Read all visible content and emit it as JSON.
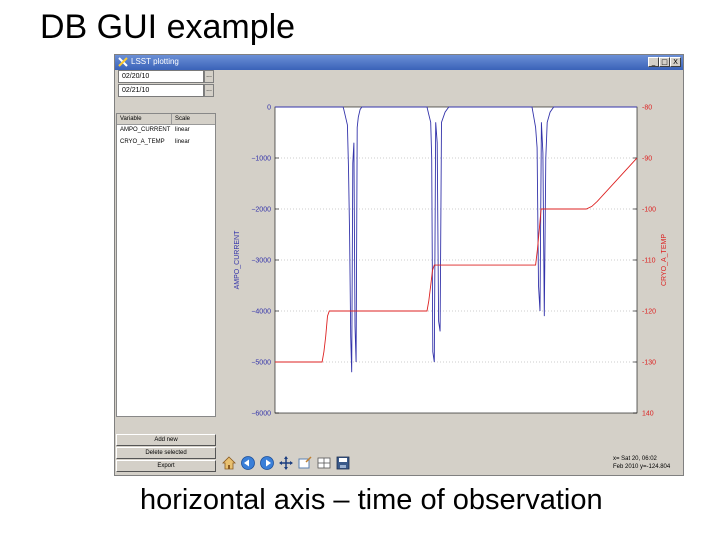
{
  "slide": {
    "title": "DB GUI example",
    "caption": "horizontal axis – time of observation"
  },
  "window": {
    "title": "LSST plotting",
    "controls": {
      "minimize": "_",
      "maximize": "□",
      "close": "X"
    }
  },
  "left_panel": {
    "start_date": "02/20/10",
    "end_date": "02/21/10",
    "picker_label": "...",
    "columns": [
      "Variable",
      "Scale"
    ],
    "rows": [
      {
        "variable": "AMPO_CURRENT",
        "scale": "linear"
      },
      {
        "variable": "CRYO_A_TEMP",
        "scale": "linear"
      }
    ],
    "buttons": {
      "add": "Add new",
      "delete": "Delete selected",
      "export": "Export"
    }
  },
  "toolbar": {
    "icons": [
      "home-icon",
      "back-icon",
      "forward-icon",
      "pan-icon",
      "zoom-icon",
      "subplots-icon",
      "save-icon"
    ],
    "coord_line1": "x= Sat 20, 06:02",
    "coord_line2": "Feb 2010 y=-124.804"
  },
  "colors": {
    "left_series": "#3333aa",
    "right_series": "#dd2222"
  },
  "chart_data": {
    "type": "line",
    "xlabel": "",
    "grid": true,
    "left_axis": {
      "label": "AMPO_CURRENT",
      "ylim": [
        -6000,
        0
      ],
      "ticks": [
        "0",
        "−1000",
        "−2000",
        "−3000",
        "−4000",
        "−5000",
        "−6000"
      ]
    },
    "right_axis": {
      "label": "CRYO_A_TEMP",
      "ylim": [
        -140,
        -80
      ],
      "ticks": [
        "-80",
        "-90",
        "-100",
        "-110",
        "-120",
        "-130",
        "140"
      ]
    },
    "series": [
      {
        "name": "AMPO_CURRENT",
        "axis": "left",
        "x": [
          0,
          0.188,
          0.19,
          0.195,
          0.2,
          0.203,
          0.206,
          0.209,
          0.212,
          0.215,
          0.218,
          0.221,
          0.224,
          0.227,
          0.23,
          0.235,
          0.24,
          0.42,
          0.425,
          0.43,
          0.433,
          0.436,
          0.44,
          0.444,
          0.448,
          0.452,
          0.456,
          0.46,
          0.47,
          0.48,
          0.71,
          0.715,
          0.72,
          0.724,
          0.728,
          0.732,
          0.736,
          0.74,
          0.744,
          0.748,
          0.752,
          0.76,
          0.77,
          1
        ],
        "y": [
          0,
          0,
          -50,
          -200,
          -350,
          -1200,
          -2500,
          -4500,
          -5200,
          -1100,
          -700,
          -4300,
          -5000,
          -400,
          -200,
          -50,
          0,
          0,
          -150,
          -300,
          -1000,
          -4800,
          -5000,
          -300,
          -700,
          -4200,
          -4400,
          -300,
          -100,
          0,
          0,
          -200,
          -400,
          -800,
          -3500,
          -4000,
          -300,
          -900,
          -4100,
          -1000,
          -300,
          -100,
          0,
          0
        ]
      },
      {
        "name": "CRYO_A_TEMP",
        "axis": "right",
        "x": [
          0,
          0.13,
          0.135,
          0.14,
          0.145,
          0.15,
          0.42,
          0.425,
          0.43,
          0.435,
          0.44,
          0.72,
          0.725,
          0.73,
          0.735,
          0.86,
          0.875,
          0.89,
          1
        ],
        "y": [
          -130,
          -130,
          -128,
          -125,
          -121,
          -120,
          -120,
          -118,
          -115,
          -112,
          -111,
          -111,
          -108,
          -104,
          -100,
          -100,
          -99.5,
          -98.5,
          -90
        ]
      }
    ]
  }
}
